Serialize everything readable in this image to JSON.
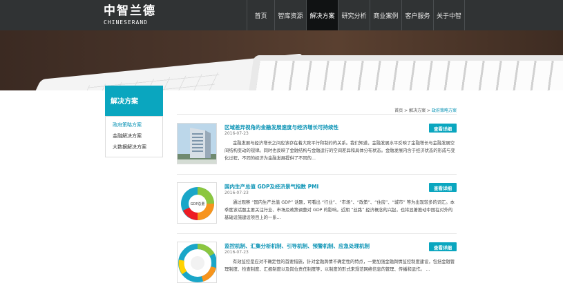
{
  "logo": {
    "cn": "中智兰德",
    "en": "CHINESERAND"
  },
  "nav": [
    {
      "label": "首页",
      "active": false
    },
    {
      "label": "智库资源",
      "active": false
    },
    {
      "label": "解决方案",
      "active": true
    },
    {
      "label": "研究分析",
      "active": false
    },
    {
      "label": "商业案例",
      "active": false
    },
    {
      "label": "客户服务",
      "active": false
    },
    {
      "label": "关于中智",
      "active": false
    }
  ],
  "sidebar": {
    "title": "解决方案",
    "items": [
      {
        "label": "政府策略方案",
        "active": true
      },
      {
        "label": "金融解决方案",
        "active": false
      },
      {
        "label": "大数据解决方案",
        "active": false
      }
    ]
  },
  "breadcrumb": {
    "home": "首页",
    "sep1": ">",
    "section": "解决方案",
    "sep2": ">",
    "current": "政府策略方案"
  },
  "articles": [
    {
      "title": "区域差异视角的金融发展速度与经济增长可持续性",
      "date": "2016-07-23",
      "body": "金融发展与经济增长之间应该存在着大致平行和制约的关系。我们知道，金融发展水平反映了金融增长与金融发展空间结构变动的规律。同时也反映了金融结构与金融运行的空间差异和具体分布状态。金融发展内含于经济状态的形成与变化过程，不同的经济为金融发展提供了不同的...",
      "button": "查看详细"
    },
    {
      "title": "国内生产总值 GDP及经济景气指数 PMI",
      "date": "2016-07-23",
      "body": "通过观察 “国内生产总值 GDP” 话题，可看出 “行业”、“市场”、“政策”、“住房”、“城市” 等为出现较多的词汇。本季度该话题主要关注行业、市场及政策调整对 GDP 的影响。近期 “丝路” 经济概念的兴起，也将显著推动中国在对外的基础设施建设项目上的一系...",
      "button": "查看详细"
    },
    {
      "title": "监控机制、汇集分析机制、引导机制、预警机制、应急处理机制",
      "date": "2016-07-23",
      "body": "有效监控是应对不确定性的首要措施，针对金融舆情不确定性的特点，一要加强金融舆情监控制度建设，包括金融管理制度、检查制度、汇报制度以及岗位责任制度等，以制度的形式来规范网络信息的管理、传播和运作。    ...",
      "button": "查看详细"
    }
  ],
  "thumb_labels": {
    "gdp": "GDP总量"
  },
  "colors": {
    "accent": "#0aa6bf",
    "link": "#0a93b5",
    "topbar": "#303334"
  }
}
